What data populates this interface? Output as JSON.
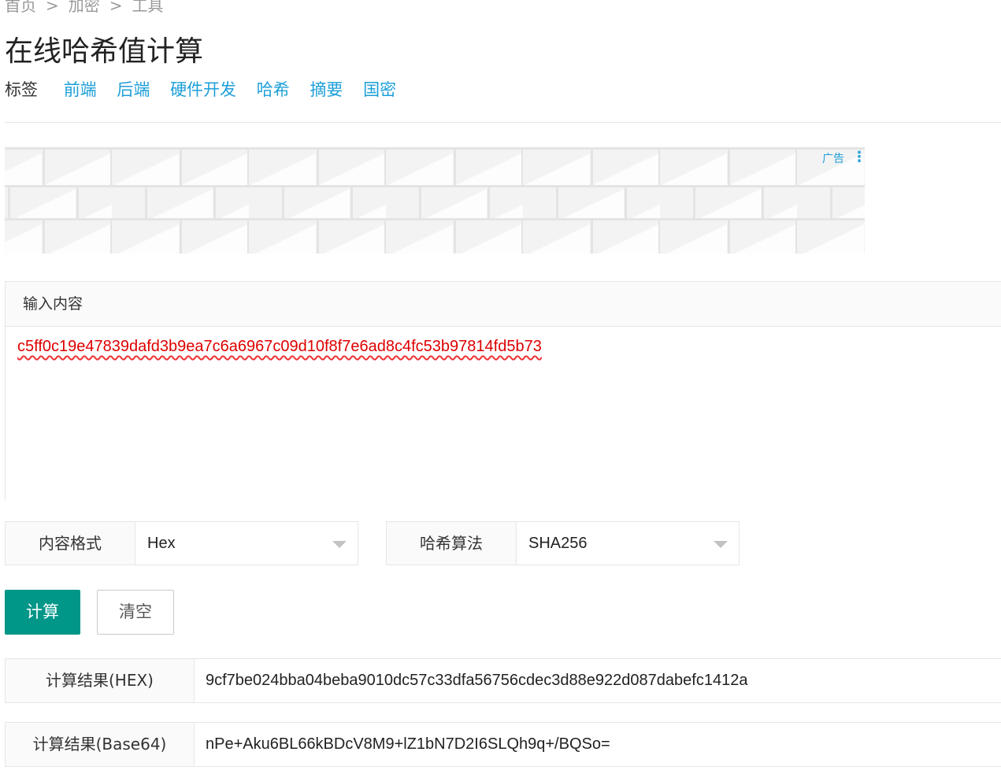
{
  "breadcrumb": {
    "home": "首页",
    "encrypt": "加密",
    "tools": "工具",
    "separator": ">"
  },
  "page": {
    "title": "在线哈希值计算"
  },
  "tags": {
    "label": "标签",
    "items": [
      "前端",
      "后端",
      "硬件开发",
      "哈希",
      "摘要",
      "国密"
    ]
  },
  "ad": {
    "label": "广告",
    "menu_icon": "more-vertical-icon"
  },
  "input": {
    "header": "输入内容",
    "value": "c5ff0c19e47839dafd3b9ea7c6a6967c09d10f8f7e6ad8c4fc53b97814fd5b73"
  },
  "options": {
    "format": {
      "label": "内容格式",
      "selected": "Hex"
    },
    "algorithm": {
      "label": "哈希算法",
      "selected": "SHA256"
    }
  },
  "buttons": {
    "compute": "计算",
    "clear": "清空"
  },
  "results": {
    "hex": {
      "label": "计算结果(HEX)",
      "value": "9cf7be024bba04beba9010dc57c33dfa56756cdec3d88e922d087dabefc1412a"
    },
    "base64": {
      "label": "计算结果(Base64)",
      "value": "nPe+Aku6BL66kBDcV8M9+lZ1bN7D2I6SLQh9q+/BQSo="
    }
  },
  "colors": {
    "accent": "#009688",
    "link": "#1e9fd8",
    "spellcheck": "#e33333"
  }
}
